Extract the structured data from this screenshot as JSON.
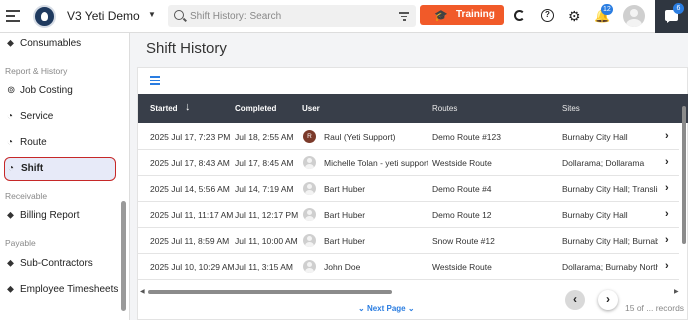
{
  "header": {
    "app_title": "V3 Yeti Demo",
    "search_placeholder": "Shift History: Search",
    "training_label": "Training",
    "notification_count": "12",
    "chat_count": "6"
  },
  "sidebar": {
    "items": [
      {
        "label": "Consumables",
        "icon": "consumables-icon"
      },
      {
        "section": "Report & History"
      },
      {
        "label": "Job Costing",
        "icon": "job-costing-icon"
      },
      {
        "label": "Service",
        "icon": "service-icon"
      },
      {
        "label": "Route",
        "icon": "route-icon"
      },
      {
        "label": "Shift",
        "icon": "shift-icon",
        "active": true
      },
      {
        "section": "Receivable"
      },
      {
        "label": "Billing Report",
        "icon": "billing-icon"
      },
      {
        "section": "Payable"
      },
      {
        "label": "Sub-Contractors",
        "icon": "sub-contractors-icon"
      },
      {
        "label": "Employee Timesheets",
        "icon": "timesheets-icon"
      }
    ]
  },
  "main": {
    "page_title": "Shift History",
    "columns": [
      "Started",
      "Completed",
      "User",
      "Routes",
      "Sites"
    ],
    "rows": [
      {
        "started": "2025 Jul 17, 7:23 PM",
        "completed": "Jul 18, 2:55 AM",
        "avatar_initial": "R",
        "user": "Raul (Yeti Support)",
        "routes": "Demo Route #123",
        "sites": "Burnaby City Hall"
      },
      {
        "started": "2025 Jul 17, 8:43 AM",
        "completed": "Jul 17, 8:45 AM",
        "avatar_initial": "",
        "user": "Michelle Tolan - yeti support",
        "routes": "Westside Route",
        "sites": "Dollarama; Dollarama"
      },
      {
        "started": "2025 Jul 14, 5:56 AM",
        "completed": "Jul 14, 7:19 AM",
        "avatar_initial": "",
        "user": "Bart Huber",
        "routes": "Demo Route #4",
        "sites": "Burnaby City Hall; Translink"
      },
      {
        "started": "2025 Jul 11, 11:17 AM",
        "completed": "Jul 11, 12:17 PM",
        "avatar_initial": "",
        "user": "Bart Huber",
        "routes": "Demo Route 12",
        "sites": "Burnaby City Hall"
      },
      {
        "started": "2025 Jul 11, 8:59 AM",
        "completed": "Jul 11, 10:00 AM",
        "avatar_initial": "",
        "user": "Bart Huber",
        "routes": "Snow Route #12",
        "sites": "Burnaby City Hall; Burnaby"
      },
      {
        "started": "2025 Jul 10, 10:29 AM",
        "completed": "Jul 11, 3:15 AM",
        "avatar_initial": "",
        "user": "John Doe",
        "routes": "Westside Route",
        "sites": "Dollarama; Burnaby North S"
      }
    ],
    "next_page_label": "Next Page",
    "records_label": "15 of ... records"
  },
  "colors": {
    "accent": "#f15a29",
    "link": "#2a7de1",
    "table_header": "#383e49",
    "active_border": "#c62828",
    "active_bg": "#e7eaf8"
  }
}
